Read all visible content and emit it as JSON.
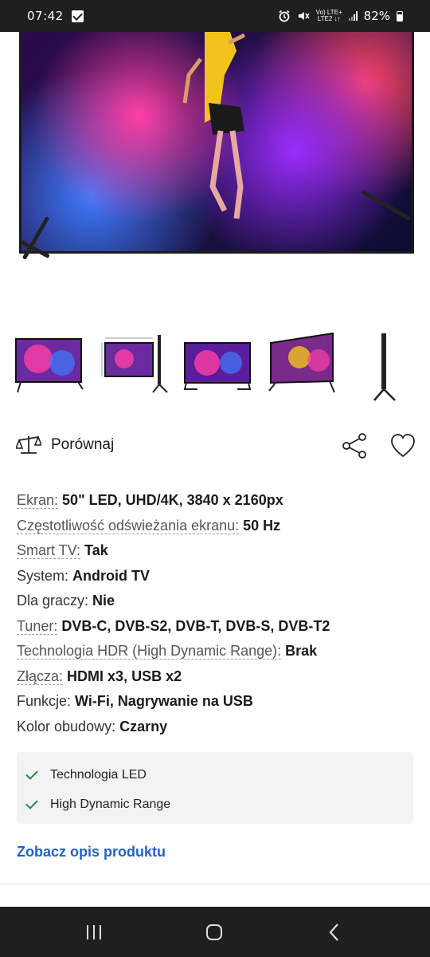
{
  "status_bar": {
    "time": "07:42",
    "network_label_top": "Vo) LTE+",
    "network_label_bottom": "LTE2 ↓↑",
    "battery": "82%"
  },
  "hero": {
    "image_icon": "tv-product-photo"
  },
  "thumbnails": [
    {
      "icon": "tv-thumbnail-front"
    },
    {
      "icon": "tv-thumbnail-dimensions"
    },
    {
      "icon": "tv-thumbnail-front-dark"
    },
    {
      "icon": "tv-thumbnail-angled"
    },
    {
      "icon": "tv-thumbnail-side"
    }
  ],
  "actions": {
    "compare_label": "Porównaj",
    "compare_icon": "scales-icon",
    "share_icon": "share-icon",
    "favorite_icon": "heart-icon"
  },
  "specs": [
    {
      "label": "Ekran:",
      "value": "50\" LED, UHD/4K, 3840 x 2160px",
      "dotted": true
    },
    {
      "label": "Częstotliwość odświeżania ekranu:",
      "value": "50 Hz",
      "dotted": true
    },
    {
      "label": "Smart TV:",
      "value": "Tak",
      "dotted": true
    },
    {
      "label": "System:",
      "value": "Android TV",
      "dotted": false
    },
    {
      "label": "Dla graczy:",
      "value": "Nie",
      "dotted": false
    },
    {
      "label": "Tuner:",
      "value": "DVB-C, DVB-S2, DVB-T, DVB-S, DVB-T2",
      "dotted": true
    },
    {
      "label": "Technologia HDR (High Dynamic Range):",
      "value": "Brak",
      "dotted": true
    },
    {
      "label": "Złącza:",
      "value": "HDMI x3, USB x2",
      "dotted": true
    },
    {
      "label": "Funkcje:",
      "value": "Wi-Fi, Nagrywanie na USB",
      "dotted": false
    },
    {
      "label": "Kolor obudowy:",
      "value": "Czarny",
      "dotted": false
    }
  ],
  "features": [
    {
      "label": "Technologia LED"
    },
    {
      "label": "High Dynamic Range"
    }
  ],
  "see_description": "Zobacz opis produktu",
  "colors": {
    "link": "#1f62c8",
    "check": "#1f8a3a",
    "system_bar": "#1f1f1f"
  }
}
